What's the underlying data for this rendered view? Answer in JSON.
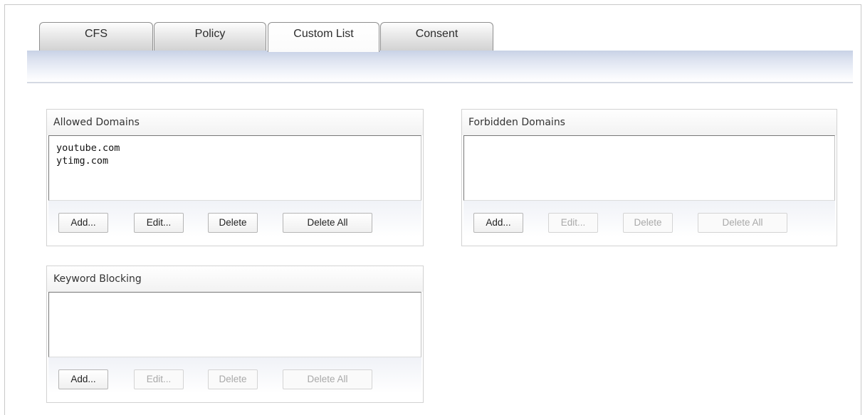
{
  "tabs": [
    {
      "label": "CFS",
      "active": false
    },
    {
      "label": "Policy",
      "active": false
    },
    {
      "label": "Custom List",
      "active": true
    },
    {
      "label": "Consent",
      "active": false
    }
  ],
  "panels": {
    "allowed": {
      "title": "Allowed Domains",
      "items": [
        "youtube.com",
        "ytimg.com"
      ],
      "buttons": [
        {
          "label": "Add...",
          "enabled": true
        },
        {
          "label": "Edit...",
          "enabled": true
        },
        {
          "label": "Delete",
          "enabled": true
        },
        {
          "label": "Delete All",
          "enabled": true
        }
      ]
    },
    "forbidden": {
      "title": "Forbidden Domains",
      "items": [],
      "buttons": [
        {
          "label": "Add...",
          "enabled": true
        },
        {
          "label": "Edit...",
          "enabled": false
        },
        {
          "label": "Delete",
          "enabled": false
        },
        {
          "label": "Delete All",
          "enabled": false
        }
      ]
    },
    "keyword": {
      "title": "Keyword Blocking",
      "items": [],
      "buttons": [
        {
          "label": "Add...",
          "enabled": true
        },
        {
          "label": "Edit...",
          "enabled": false
        },
        {
          "label": "Delete",
          "enabled": false
        },
        {
          "label": "Delete All",
          "enabled": false
        }
      ]
    }
  },
  "colors": {
    "tab_bar_top": "#c8d2e6",
    "border": "#d2d2d2",
    "disabled_text": "#a9a9a9"
  }
}
